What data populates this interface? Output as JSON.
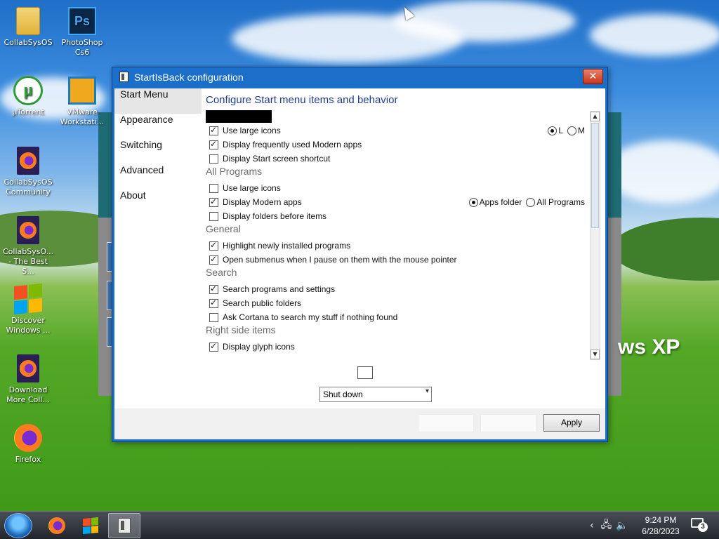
{
  "desktop": {
    "icons": [
      {
        "label": "CollabSysOS",
        "icon": "folder-icon"
      },
      {
        "label": "PhotoShop Cs6",
        "icon": "photoshop-icon"
      },
      {
        "label": "µTorrent",
        "icon": "utorrent-icon"
      },
      {
        "label": "VMware Workstati...",
        "icon": "vmware-icon"
      },
      {
        "label": "CollabSysOS Community",
        "icon": "firefox-document-icon"
      },
      {
        "label": "CollabSysO... - The Best S...",
        "icon": "firefox-document-icon"
      },
      {
        "label": "Discover Windows ...",
        "icon": "windows-logo-icon"
      },
      {
        "label": "Download More Coll...",
        "icon": "firefox-document-icon"
      },
      {
        "label": "Firefox",
        "icon": "firefox-icon"
      }
    ],
    "wallpaper_text": "ws XP"
  },
  "dialog": {
    "title": "StartIsBack configuration",
    "close_glyph": "✕",
    "nav": [
      "Start Menu",
      "Appearance",
      "Switching",
      "Advanced",
      "About"
    ],
    "active_nav": "Start Menu",
    "heading": "Configure Start menu items and behavior",
    "rows": [
      {
        "kind": "checkbox",
        "label": "Use large icons",
        "checked": true,
        "radios": [
          {
            "label": "L",
            "selected": true
          },
          {
            "label": "M",
            "selected": false
          }
        ]
      },
      {
        "kind": "checkbox",
        "label": "Display frequently used Modern apps",
        "checked": true
      },
      {
        "kind": "checkbox",
        "label": "Display Start screen shortcut",
        "checked": false
      },
      {
        "kind": "group",
        "label": "All Programs"
      },
      {
        "kind": "checkbox",
        "label": "Use large icons",
        "checked": false
      },
      {
        "kind": "checkbox",
        "label": "Display Modern apps",
        "checked": true,
        "radios": [
          {
            "label": "Apps folder",
            "selected": true
          },
          {
            "label": "All Programs",
            "selected": false
          }
        ]
      },
      {
        "kind": "checkbox",
        "label": "Display folders before items",
        "checked": false
      },
      {
        "kind": "group",
        "label": "General"
      },
      {
        "kind": "checkbox",
        "label": "Highlight newly installed programs",
        "checked": true
      },
      {
        "kind": "checkbox",
        "label": "Open submenus when I pause on them with the mouse pointer",
        "checked": true
      },
      {
        "kind": "group",
        "label": "Search"
      },
      {
        "kind": "checkbox",
        "label": "Search programs and settings",
        "checked": true
      },
      {
        "kind": "checkbox",
        "label": "Search public folders",
        "checked": true
      },
      {
        "kind": "checkbox",
        "label": "Ask Cortana to search my stuff if nothing found",
        "checked": false
      },
      {
        "kind": "group",
        "label": "Right side items"
      },
      {
        "kind": "checkbox",
        "label": "Display glyph icons",
        "checked": true
      }
    ],
    "power_button_selected": "Shut down",
    "apply_label": "Apply"
  },
  "taskbar": {
    "clock_time": "9:24 PM",
    "clock_date": "6/28/2023",
    "notification_count": "3"
  }
}
